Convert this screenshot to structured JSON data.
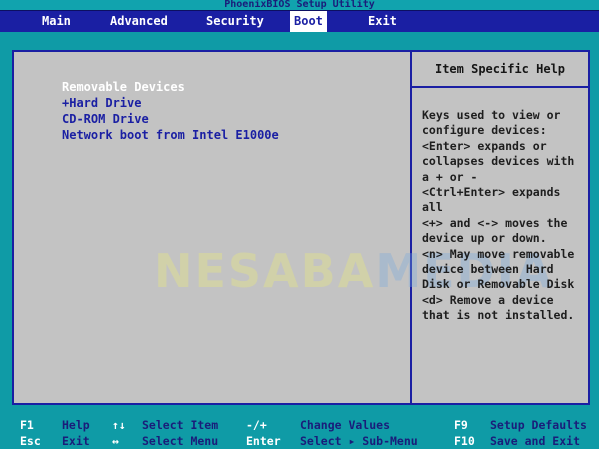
{
  "app": {
    "title": "PhoenixBIOS Setup Utility"
  },
  "menu": {
    "items": [
      "Main",
      "Advanced",
      "Security",
      "Boot",
      "Exit"
    ],
    "active": "Boot"
  },
  "boot": {
    "items": [
      {
        "label": "Removable Devices",
        "selected": true
      },
      {
        "label": "+Hard Drive",
        "selected": false
      },
      {
        "label": "CD-ROM Drive",
        "selected": false
      },
      {
        "label": "Network boot from Intel E1000e",
        "selected": false
      }
    ]
  },
  "help": {
    "header": "Item Specific Help",
    "lines": [
      "Keys used to view or",
      "configure devices:",
      "<Enter> expands or",
      "collapses devices with",
      "a + or -",
      "<Ctrl+Enter> expands",
      "all",
      "<+> and <-> moves the",
      "device up or down.",
      "<n> May move removable",
      "device between Hard",
      "Disk or Removable Disk",
      "<d> Remove a device",
      "that is not installed."
    ]
  },
  "watermark": {
    "part1": "NESABA",
    "part2": "MEDIA"
  },
  "footer": {
    "row1": [
      {
        "key": "F1",
        "desc": "Help"
      },
      {
        "key": "↑↓",
        "desc": "Select Item"
      },
      {
        "key": "-/+",
        "desc": "Change Values"
      },
      {
        "key": "F9",
        "desc": "Setup Defaults"
      }
    ],
    "row2": [
      {
        "key": "Esc",
        "desc": "Exit"
      },
      {
        "key": "↔",
        "desc": "Select Menu"
      },
      {
        "key": "Enter",
        "desc": "Select ▸ Sub-Menu"
      },
      {
        "key": "F10",
        "desc": "Save and Exit"
      }
    ]
  }
}
